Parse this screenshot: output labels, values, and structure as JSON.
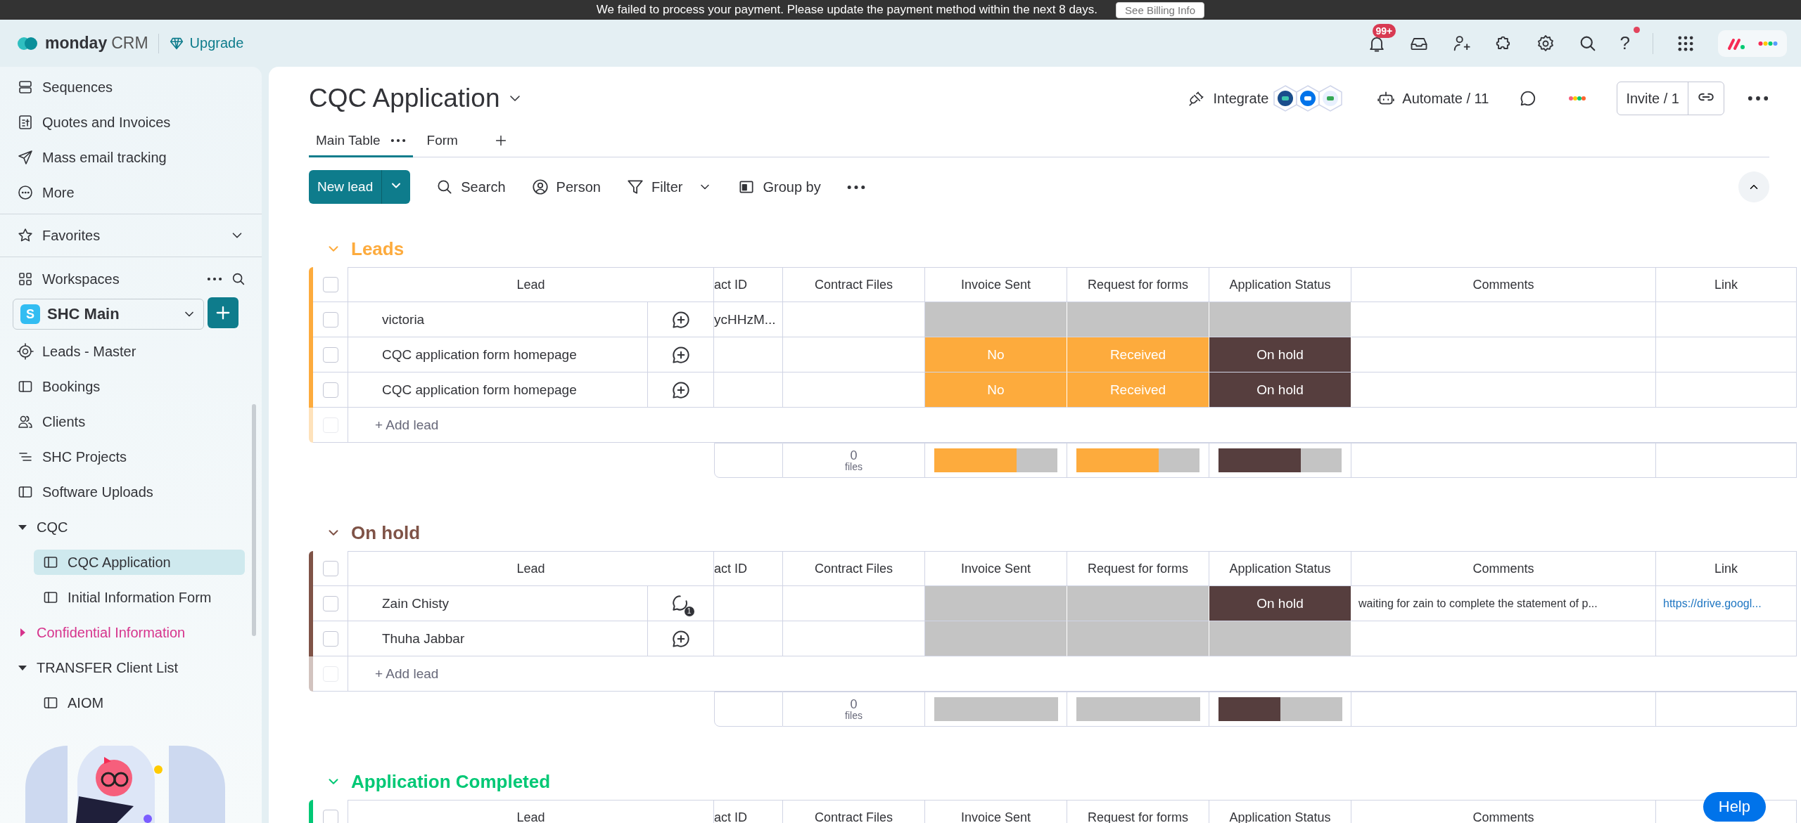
{
  "banner": {
    "message": "We failed to process your payment. Please update the payment method within the next 8 days.",
    "button": "See Billing Info"
  },
  "topbar": {
    "brand": "monday",
    "product": "CRM",
    "upgrade": "Upgrade",
    "notifications": "99+",
    "help": "?",
    "help_alert": true
  },
  "sidebar": {
    "items": [
      {
        "kind": "sequences",
        "label": "Sequences"
      },
      {
        "kind": "quotes",
        "label": "Quotes and Invoices"
      },
      {
        "kind": "email",
        "label": "Mass email tracking"
      },
      {
        "kind": "more",
        "label": "More"
      }
    ],
    "favorites": {
      "label": "Favorites",
      "expanded": false
    },
    "workspaces": {
      "label": "Workspaces",
      "initial": "S",
      "current": "SHC Main",
      "boards": [
        {
          "kind": "target",
          "label": "Leads - Master",
          "selected": false
        },
        {
          "kind": "board",
          "label": "Bookings",
          "selected": false
        },
        {
          "kind": "people",
          "label": "Clients",
          "selected": false
        },
        {
          "kind": "projects",
          "label": "SHC Projects",
          "selected": false
        },
        {
          "kind": "board",
          "label": "Software Uploads",
          "selected": false
        },
        {
          "kind": "folder",
          "label": "CQC",
          "expanded": true,
          "color": "#323338",
          "children": [
            {
              "kind": "board",
              "label": "CQC Application",
              "selected": true
            },
            {
              "kind": "board",
              "label": "Initial Information Form",
              "selected": false
            }
          ]
        },
        {
          "kind": "folder",
          "label": "Confidential Information",
          "expanded": false,
          "color": "#d6338c"
        },
        {
          "kind": "folder",
          "label": "TRANSFER Client List",
          "expanded": true,
          "color": "#323338",
          "children": [
            {
              "kind": "board",
              "label": "AIOM",
              "selected": false
            }
          ]
        }
      ]
    }
  },
  "board": {
    "title": "CQC Application",
    "tabs": [
      {
        "label": "Main Table",
        "selected": true
      },
      {
        "label": "Form",
        "selected": false
      }
    ],
    "integrate": "Integrate",
    "automate": "Automate / 11",
    "invite": "Invite / 1",
    "new_item": "New lead",
    "toolbar": [
      {
        "kind": "search",
        "label": "Search"
      },
      {
        "kind": "person",
        "label": "Person"
      },
      {
        "kind": "filter",
        "label": "Filter"
      },
      {
        "kind": "group",
        "label": "Group by"
      }
    ],
    "groups": [
      {
        "title": "Leads",
        "color": "#fdab3d",
        "all_checked": false,
        "columns": [
          "Lead",
          "act ID",
          "Contract Files",
          "Invoice Sent",
          "Request for forms",
          "Application Status",
          "Comments",
          "Link"
        ],
        "add_label": "+ Add lead",
        "add_checked": false,
        "rows": [
          {
            "checked": false,
            "lead": "victoria",
            "updates": {
              "kind": "add"
            },
            "contact_id": "ycHHzM...",
            "invoice": {
              "color": "#c4c4c4"
            },
            "request": {
              "color": "#c4c4c4"
            },
            "status": {
              "color": "#c4c4c4"
            }
          },
          {
            "checked": false,
            "lead": "CQC application form homepage",
            "updates": {
              "kind": "add"
            },
            "invoice": {
              "text": "No",
              "color": "#fdab3d"
            },
            "request": {
              "text": "Received",
              "color": "#fdab3d"
            },
            "status": {
              "text": "On hold",
              "color": "#563e3e"
            }
          },
          {
            "checked": false,
            "lead": "CQC application form homepage",
            "updates": {
              "kind": "add"
            },
            "invoice": {
              "text": "No",
              "color": "#fdab3d"
            },
            "request": {
              "text": "Received",
              "color": "#fdab3d"
            },
            "status": {
              "text": "On hold",
              "color": "#563e3e"
            }
          }
        ],
        "summary": {
          "files_count": "0",
          "files_label": "files",
          "bars": [
            {
              "segments": [
                {
                  "color": "#fdab3d",
                  "level": 0.67
                },
                {
                  "color": "#c4c4c4",
                  "level": 0.33
                }
              ]
            },
            {
              "segments": [
                {
                  "color": "#fdab3d",
                  "level": 0.67
                },
                {
                  "color": "#c4c4c4",
                  "level": 0.33
                }
              ]
            },
            {
              "segments": [
                {
                  "color": "#563e3e",
                  "level": 0.67
                },
                {
                  "color": "#c4c4c4",
                  "level": 0.33
                }
              ]
            }
          ]
        }
      },
      {
        "title": "On hold",
        "color": "#7f5347",
        "all_checked": false,
        "columns": [
          "Lead",
          "act ID",
          "Contract Files",
          "Invoice Sent",
          "Request for forms",
          "Application Status",
          "Comments",
          "Link"
        ],
        "add_label": "+ Add lead",
        "add_checked": false,
        "rows": [
          {
            "checked": false,
            "lead": "Zain Chisty",
            "updates": {
              "kind": "count",
              "count": "1"
            },
            "invoice": {
              "color": "#c4c4c4"
            },
            "request": {
              "color": "#c4c4c4"
            },
            "status": {
              "text": "On hold",
              "color": "#563e3e"
            },
            "comments": "waiting for zain to complete the statement of p...",
            "link": "https://drive.googl..."
          },
          {
            "checked": false,
            "lead": "Thuha Jabbar",
            "updates": {
              "kind": "add"
            },
            "invoice": {
              "color": "#c4c4c4"
            },
            "request": {
              "color": "#c4c4c4"
            },
            "status": {
              "color": "#c4c4c4"
            }
          }
        ],
        "summary": {
          "files_count": "0",
          "files_label": "files",
          "bars": [
            {
              "segments": [
                {
                  "color": "#c4c4c4",
                  "level": 1
                }
              ]
            },
            {
              "segments": [
                {
                  "color": "#c4c4c4",
                  "level": 1
                }
              ]
            },
            {
              "segments": [
                {
                  "color": "#563e3e",
                  "level": 0.5
                },
                {
                  "color": "#c4c4c4",
                  "level": 0.5
                }
              ]
            }
          ]
        }
      },
      {
        "title": "Application Completed",
        "color": "#00c875",
        "all_checked": false,
        "columns": [
          "Lead",
          "act ID",
          "Contract Files",
          "Invoice Sent",
          "Request for forms",
          "Application Status",
          "Comments"
        ]
      }
    ]
  },
  "help": "Help"
}
